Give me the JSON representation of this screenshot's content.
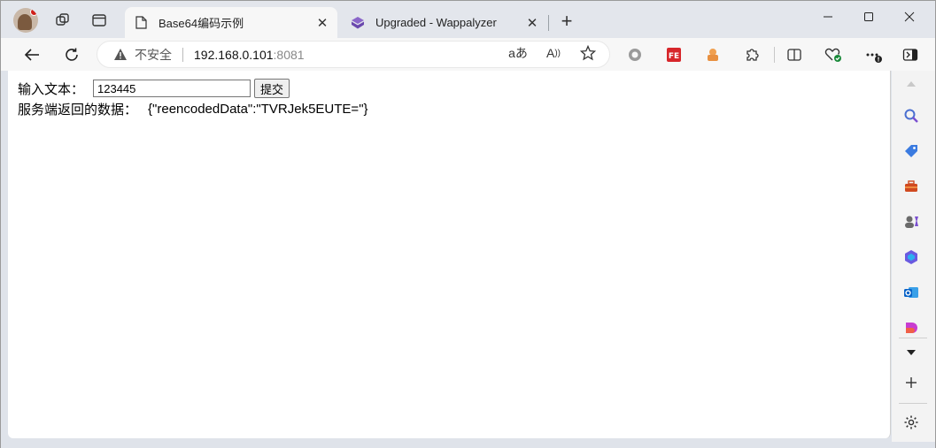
{
  "browser": {
    "tabs": [
      {
        "label": "Base64编码示例",
        "active": true
      },
      {
        "label": "Upgraded - Wappalyzer",
        "active": false
      }
    ],
    "new_tab_label": "+",
    "address": {
      "security_label": "不安全",
      "host": "192.168.0.101",
      "port": ":8081"
    }
  },
  "page": {
    "input_label": "输入文本：",
    "input_value": "123445",
    "submit_label": "提交",
    "response_label": "服务端返回的数据：",
    "response_value": "{\"reencodedData\":\"TVRJek5EUTE=\"}"
  },
  "icons": {
    "window_minimize": "minimize-icon",
    "window_maximize": "maximize-icon",
    "window_close": "close-icon"
  },
  "colors": {
    "tab_bar": "#e3e6ec",
    "toolbar": "#f7f7f7",
    "page_bg": "#ffffff"
  }
}
